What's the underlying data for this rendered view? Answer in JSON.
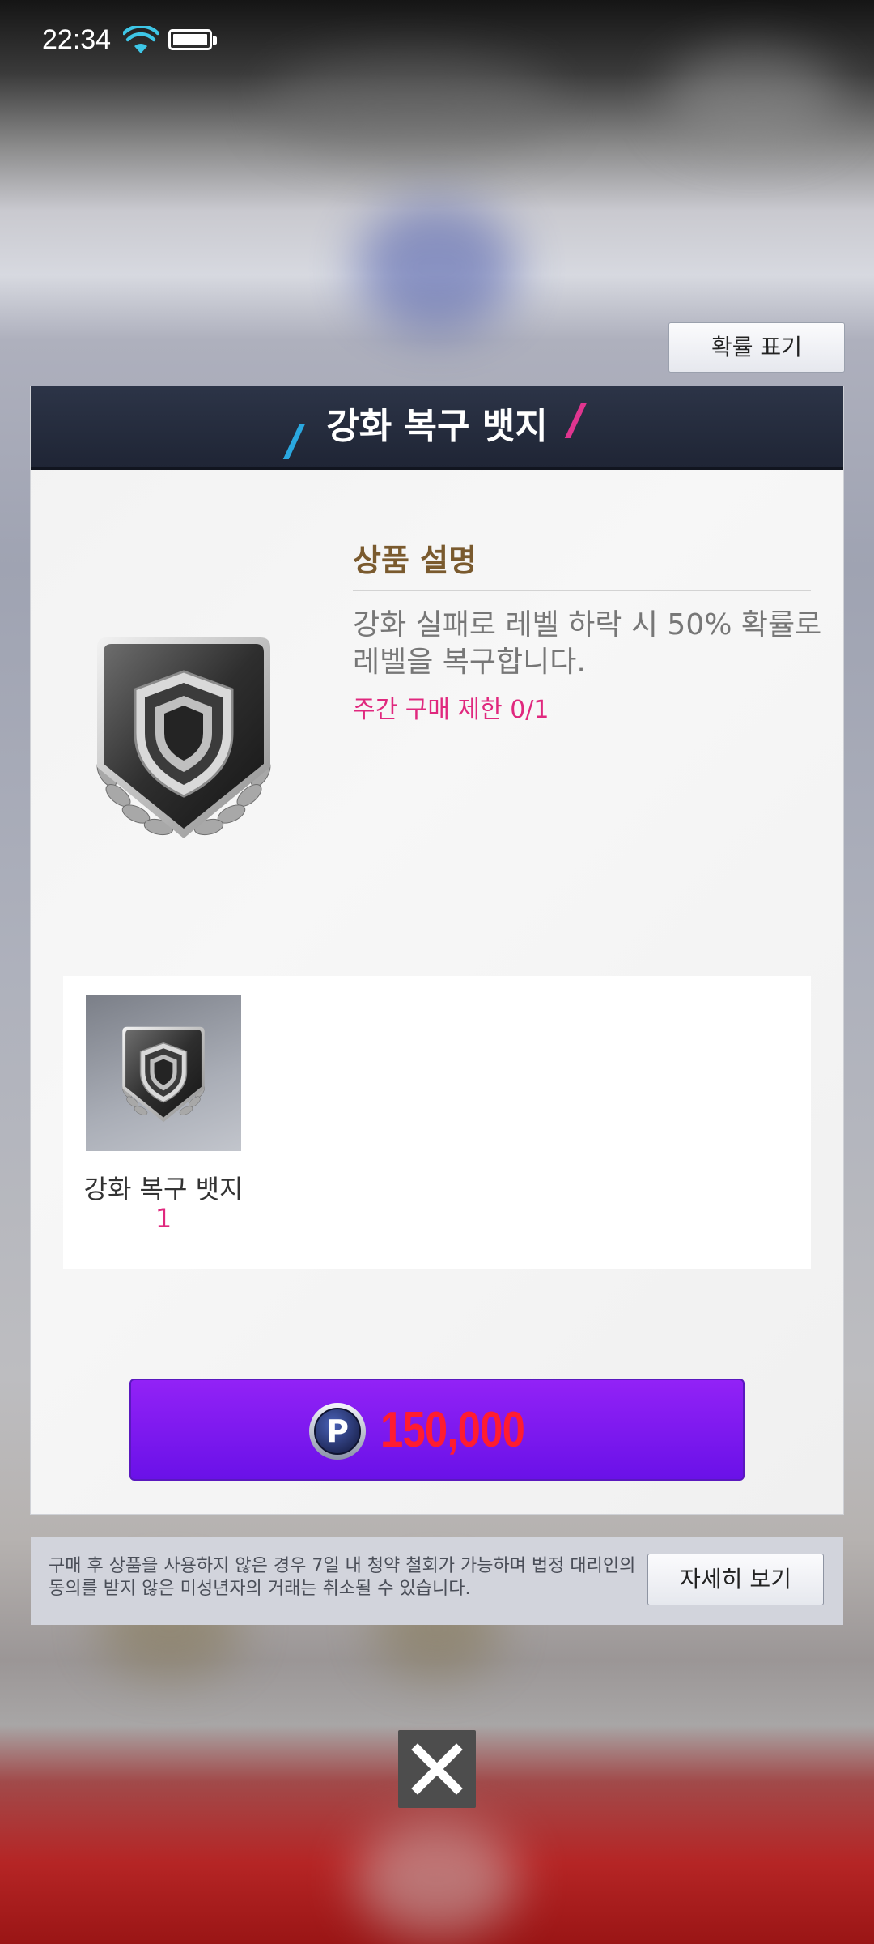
{
  "status_bar": {
    "time": "22:34",
    "wifi_icon": "wifi-icon",
    "battery_icon": "battery-icon"
  },
  "probability_button": {
    "label": "확률 표기"
  },
  "dialog": {
    "title": "강화 복구 뱃지",
    "description": {
      "heading": "상품 설명",
      "text": "강화 실패로 레벨 하락 시 50% 확률로 레벨을 복구합니다.",
      "limit": "주간 구매 제한 0/1"
    },
    "item": {
      "name": "강화 복구 뱃지",
      "count": "1",
      "icon": "shield-badge-icon"
    },
    "buy_button": {
      "price": "150,000",
      "currency_icon": "p-coin-icon"
    }
  },
  "notice": {
    "text": "구매 후 상품을 사용하지 않은 경우 7일 내 청약 철회가 가능하며 법정 대리인의 동의를 받지 않은 미성년자의 거래는 취소될 수 있습니다.",
    "details_button": "자세히 보기"
  },
  "close_button": {
    "icon": "close-icon"
  },
  "colors": {
    "accent_pink": "#e0287e",
    "buy_purple": "#7c1aee",
    "price_red": "#ff1c30",
    "header_navy": "#262d3e"
  }
}
